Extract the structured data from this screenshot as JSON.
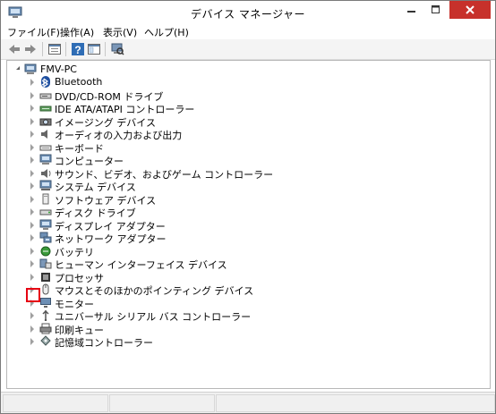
{
  "window": {
    "title": "デバイス マネージャー"
  },
  "menu": [
    {
      "label": "ファイル(F)"
    },
    {
      "label": "操作(A)"
    },
    {
      "label": "表示(V)"
    },
    {
      "label": "ヘルプ(H)"
    }
  ],
  "toolbar": [
    "back-icon",
    "forward-icon",
    "properties-icon",
    "help-icon",
    "console-icon",
    "scan-hardware-icon"
  ],
  "tree": {
    "root": "FMV-PC",
    "items": [
      {
        "label": "Bluetooth",
        "icon": "bluetooth-icon"
      },
      {
        "label": "DVD/CD-ROM ドライブ",
        "icon": "dvd-drive-icon"
      },
      {
        "label": "IDE ATA/ATAPI コントローラー",
        "icon": "ide-controller-icon"
      },
      {
        "label": "イメージング デバイス",
        "icon": "imaging-device-icon"
      },
      {
        "label": "オーディオの入力および出力",
        "icon": "audio-icon"
      },
      {
        "label": "キーボード",
        "icon": "keyboard-icon"
      },
      {
        "label": "コンピューター",
        "icon": "computer-icon"
      },
      {
        "label": "サウンド、ビデオ、およびゲーム コントローラー",
        "icon": "sound-icon"
      },
      {
        "label": "システム デバイス",
        "icon": "system-device-icon"
      },
      {
        "label": "ソフトウェア デバイス",
        "icon": "software-device-icon"
      },
      {
        "label": "ディスク ドライブ",
        "icon": "disk-drive-icon"
      },
      {
        "label": "ディスプレイ アダプター",
        "icon": "display-adapter-icon"
      },
      {
        "label": "ネットワーク アダプター",
        "icon": "network-adapter-icon"
      },
      {
        "label": "バッテリ",
        "icon": "battery-icon"
      },
      {
        "label": "ヒューマン インターフェイス デバイス",
        "icon": "hid-icon"
      },
      {
        "label": "プロセッサ",
        "icon": "processor-icon"
      },
      {
        "label": "マウスとそのほかのポインティング デバイス",
        "icon": "mouse-icon"
      },
      {
        "label": "モニター",
        "icon": "monitor-icon"
      },
      {
        "label": "ユニバーサル シリアル バス コントローラー",
        "icon": "usb-icon"
      },
      {
        "label": "印刷キュー",
        "icon": "print-queue-icon"
      },
      {
        "label": "記憶域コントローラー",
        "icon": "storage-controller-icon"
      }
    ]
  },
  "highlight_color": "#e60012",
  "close_color": "#c7312b"
}
